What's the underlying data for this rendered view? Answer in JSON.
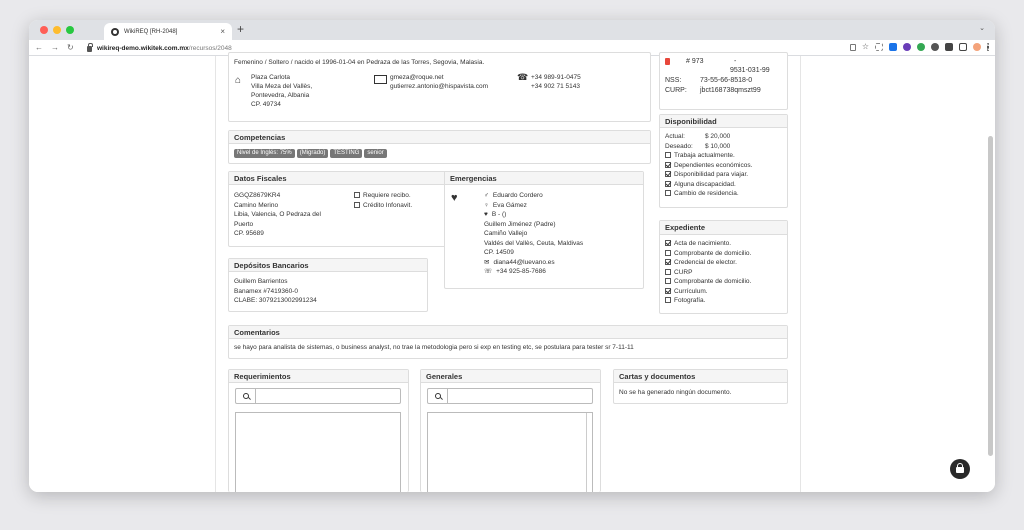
{
  "browser": {
    "tab_title": "WikiREQ [RH-2048]",
    "tab_close": "×",
    "new_tab": "+",
    "url_host": "wikireq-demo.wikitek.com.mx",
    "url_path": "/recursos/2048",
    "colors": {
      "close": "#ff5f57",
      "minimize": "#febc2e",
      "maximize": "#28c840"
    }
  },
  "profile": {
    "summary": "Femenino / Soltero / nacido el 1996-01-04 en Pedraza de las Torres, Segovia, Malasia.",
    "address": [
      "Plaza Carlota",
      "Villa Meza del Vallès,",
      "Pontevedra, Albania",
      "CP. 49734"
    ],
    "emails": [
      "gmeza@roque.net",
      "gutierrez.antonio@hispavista.com"
    ],
    "phones": [
      "+34 989-91-0475",
      "+34 902 71 5143"
    ]
  },
  "idcard": {
    "number": "# 973",
    "dash": "-",
    "phone_extra": "9531-031-99",
    "nss_label": "NSS:",
    "nss": "73-55-66-8518-0",
    "curp_label": "CURP:",
    "curp": "jbct168738qmszt99"
  },
  "competencias": {
    "title": "Competencias",
    "badges": [
      "Nivel de Inglés: 75%",
      "(Migrado)",
      "TESTING",
      "senior"
    ]
  },
  "disponibilidad": {
    "title": "Disponibilidad",
    "actual_label": "Actual:",
    "actual": "$ 20,000",
    "deseado_label": "Deseado:",
    "deseado": "$ 10,000",
    "items": [
      {
        "label": "Trabaja actualmente.",
        "checked": false
      },
      {
        "label": "Dependientes económicos.",
        "checked": true
      },
      {
        "label": "Disponibilidad para viajar.",
        "checked": true
      },
      {
        "label": "Alguna discapacidad.",
        "checked": true
      },
      {
        "label": "Cambio de residencia.",
        "checked": false
      }
    ]
  },
  "fiscales": {
    "title": "Datos Fiscales",
    "rfc": "GGQZ8679KR4",
    "lines": [
      "Camino Merino",
      "Libia, Valencia, O Pedraza del",
      "Puerto",
      "CP. 95689"
    ],
    "checks": [
      {
        "label": "Requiere recibo.",
        "checked": false
      },
      {
        "label": "Crédito Infonavit.",
        "checked": false
      }
    ]
  },
  "emergencias": {
    "title": "Emergencias",
    "male_contact": "Eduardo Cordero",
    "female_contact": "Eva Gámez",
    "blood": "B - ()",
    "lines": [
      "Guillem Jiménez (Padre)",
      "Camiño Vallejo",
      "Valdés del Vallès, Ceuta, Maldivas",
      "CP. 14509"
    ],
    "email": "diana44@luevano.es",
    "phone": "+34 925-85-7686"
  },
  "expediente": {
    "title": "Expediente",
    "items": [
      {
        "label": "Acta de nacimiento.",
        "checked": true
      },
      {
        "label": "Comprobante de domicilio.",
        "checked": false
      },
      {
        "label": "Credencial de elector.",
        "checked": true
      },
      {
        "label": "CURP",
        "checked": false
      },
      {
        "label": "Comprobante de domicilio.",
        "checked": false
      },
      {
        "label": "Currículum.",
        "checked": true
      },
      {
        "label": "Fotografía.",
        "checked": false
      }
    ]
  },
  "depositos": {
    "title": "Depósitos Bancarios",
    "lines": [
      "Guillem Barrientos",
      "Banamex #7419360-0",
      "CLABE: 3079213002991234"
    ]
  },
  "comentarios": {
    "title": "Comentarios",
    "text": "se hayo para analista de sistemas, o business analyst, no trae la metodologia pero si exp en testing etc, se postulara para tester sr 7-11-11"
  },
  "requerimientos": {
    "title": "Requerimientos",
    "search_value": ""
  },
  "generales": {
    "title": "Generales",
    "search_value": ""
  },
  "cartas": {
    "title": "Cartas y documentos",
    "empty": "No se ha generado ningún documento."
  }
}
